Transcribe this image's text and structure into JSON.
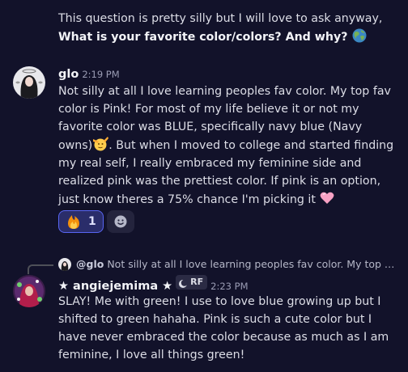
{
  "messages": {
    "continued": {
      "text_line1": "This question is pretty silly but I will love to ask anyway,",
      "text_bold": "What is your favorite color/colors? And why?",
      "emoji": "earth-emoji"
    },
    "glo": {
      "username": "glo",
      "timestamp": "2:19 PM",
      "text_part1": "Not silly at all I love learning peoples fav color. My top fav color is Pink! For most of my life believe it or not my favorite color was BLUE, specifically navy blue (Navy owns)",
      "text_part2": ". But when I moved to college and started finding my real self, I really embraced my feminine side and realized pink was the prettiest color. If pink is an option, just know theres a 75% chance I'm picking it",
      "inline_emoji_1": "saluting-face-emoji",
      "inline_emoji_2": "pink-heart-emoji",
      "reactions": [
        {
          "emoji": "fire-emoji",
          "count": "1",
          "active": true
        }
      ],
      "add_reaction_icon": "add-reaction-icon"
    },
    "angie": {
      "reply_to_name": "@glo",
      "reply_preview": "Not silly at all I love learning peoples fav color. My top fav c...",
      "username": "★ angiejemima ★",
      "tag": "RF",
      "timestamp": "2:23 PM",
      "text": "SLAY! Me with green! I use to love blue growing up but I shifted to green hahaha. Pink is such a cute color but I have never embraced the color because as much as I am feminine, I love all things green!"
    }
  },
  "colors": {
    "background": "#12122a",
    "text": "#dcdde6",
    "accent": "#5865f2",
    "muted": "#9a9cb4"
  }
}
